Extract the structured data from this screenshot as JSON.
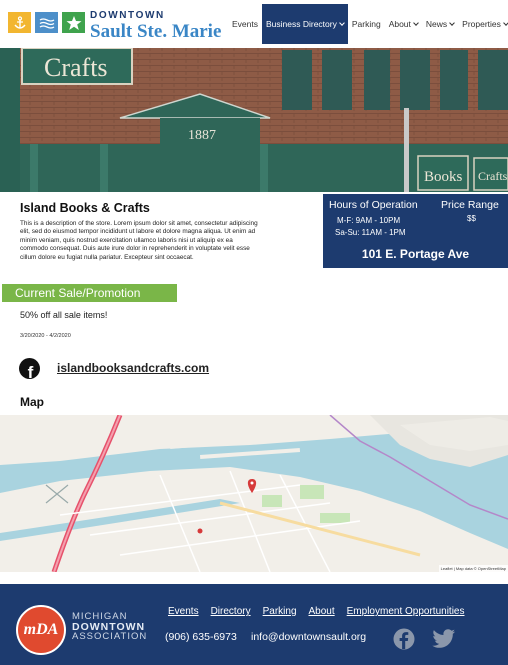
{
  "header": {
    "brand_top": "DOWNTOWN",
    "brand_bottom": "Sault Ste. Marie",
    "nav": {
      "events": "Events",
      "business_directory": "Business Directory",
      "parking": "Parking",
      "about": "About",
      "news": "News",
      "properties": "Properties"
    }
  },
  "store": {
    "name": "Island Books & Crafts",
    "description": "This is a description of the store. Lorem ipsum dolor sit amet, consectetur adipiscing elit, sed do eiusmod tempor incididunt ut labore et dolore magna aliqua. Ut enim ad minim veniam, quis nostrud exercitation ullamco laboris nisi ut aliquip ex ea commodo consequat. Duis aute irure dolor in reprehenderit in voluptate velit esse cillum dolore eu fugiat nulla pariatur. Excepteur sint occaecat.",
    "hours_title": "Hours of Operation",
    "hours_weekday": "M-F: 9AM - 10PM",
    "hours_weekend": "Sa-Su: 11AM - 1PM",
    "price_title": "Price Range",
    "price_value": "$$",
    "address": "101 E. Portage Ave",
    "sale_heading": "Current Sale/Promotion",
    "sale_text": "50% off all sale items!",
    "sale_dates": "3/20/2020 - 4/2/2020",
    "website": "islandbooksandcrafts.com",
    "map_title": "Map"
  },
  "hero_signs": {
    "crafts": "Crafts",
    "year": "1887",
    "books": "Books",
    "crafts_small": "Crafts"
  },
  "map": {
    "attribution": "Leaflet | Map data © OpenStreetMap"
  },
  "footer": {
    "org_line1": "MICHIGAN",
    "org_line2": "DOWNTOWN",
    "org_line3": "ASSOCIATION",
    "logo_text": "mDA",
    "nav": {
      "events": "Events",
      "directory": "Directory",
      "parking": "Parking",
      "about": "About",
      "employment": "Employment Opportunities"
    },
    "phone": "(906) 635-6973",
    "email": "info@downtownsault.org"
  },
  "colors": {
    "navy": "#1d3b6f",
    "green": "#7ab648",
    "brand_blue": "#3a86c6",
    "mda_red": "#e04a2f"
  }
}
